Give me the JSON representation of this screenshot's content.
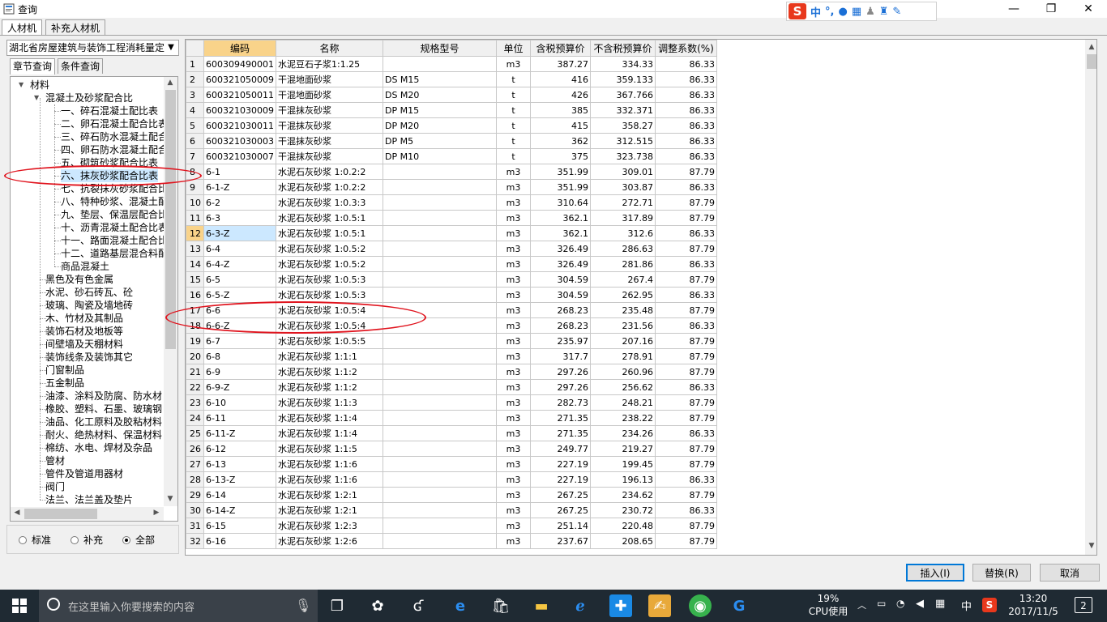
{
  "window": {
    "title": "查询",
    "ime": {
      "lang": "中"
    }
  },
  "tabs": [
    "人材机",
    "补充人材机"
  ],
  "left": {
    "dept_select": "湖北省房屋建筑与装饰工程消耗量定",
    "subtabs": [
      "章节查询",
      "条件查询"
    ],
    "tree": [
      {
        "label": "材料",
        "level": 0,
        "exp": "-"
      },
      {
        "label": "混凝土及砂浆配合比",
        "level": 1,
        "exp": "-"
      },
      {
        "label": "一、碎石混凝土配比表",
        "level": 2
      },
      {
        "label": "二、卵石混凝土配合比表",
        "level": 2
      },
      {
        "label": "三、碎石防水混凝土配合",
        "level": 2
      },
      {
        "label": "四、卵石防水混凝土配合",
        "level": 2
      },
      {
        "label": "五、砌筑砂浆配合比表",
        "level": 2
      },
      {
        "label": "六、抹灰砂浆配合比表",
        "level": 2,
        "sel": true
      },
      {
        "label": "七、抗裂抹灰砂浆配合比",
        "level": 2
      },
      {
        "label": "八、特种砂浆、混凝土配",
        "level": 2
      },
      {
        "label": "九、垫层、保温层配合比",
        "level": 2
      },
      {
        "label": "十、沥青混凝土配合比表",
        "level": 2
      },
      {
        "label": "十一、路面混凝土配合比",
        "level": 2
      },
      {
        "label": "十二、道路基层混合料配",
        "level": 2
      },
      {
        "label": "商品混凝土",
        "level": 2
      },
      {
        "label": "黑色及有色金属",
        "level": 1
      },
      {
        "label": "水泥、砂石砖瓦、砼",
        "level": 1
      },
      {
        "label": "玻璃、陶瓷及墙地砖",
        "level": 1
      },
      {
        "label": "木、竹材及其制品",
        "level": 1
      },
      {
        "label": "装饰石材及地板等",
        "level": 1
      },
      {
        "label": "间壁墙及天棚材料",
        "level": 1
      },
      {
        "label": "装饰线条及装饰其它",
        "level": 1
      },
      {
        "label": "门窗制品",
        "level": 1
      },
      {
        "label": "五金制品",
        "level": 1
      },
      {
        "label": "油漆、涂料及防腐、防水材",
        "level": 1
      },
      {
        "label": "橡胶、塑料、石墨、玻璃钢",
        "level": 1
      },
      {
        "label": "油品、化工原料及胶粘材料",
        "level": 1
      },
      {
        "label": "耐火、绝热材料、保温材料",
        "level": 1
      },
      {
        "label": "棉纺、水电、焊材及杂品",
        "level": 1
      },
      {
        "label": "管材",
        "level": 1
      },
      {
        "label": "管件及管道用器材",
        "level": 1
      },
      {
        "label": "阀门",
        "level": 1
      },
      {
        "label": "法兰、法兰盖及垫片",
        "level": 1
      }
    ],
    "radios": [
      {
        "label": "标准",
        "checked": false
      },
      {
        "label": "补充",
        "checked": false
      },
      {
        "label": "全部",
        "checked": true
      }
    ]
  },
  "grid": {
    "headers": [
      "编码",
      "名称",
      "规格型号",
      "单位",
      "含税预算价",
      "不含税预算价",
      "调整系数(%)"
    ],
    "rows": [
      [
        "1",
        "600309490001",
        "水泥豆石子浆1:1.25",
        "",
        "m3",
        "387.27",
        "334.33",
        "86.33"
      ],
      [
        "2",
        "600321050009",
        "干混地面砂浆",
        "DS M15",
        "t",
        "416",
        "359.133",
        "86.33"
      ],
      [
        "3",
        "600321050011",
        "干混地面砂浆",
        "DS M20",
        "t",
        "426",
        "367.766",
        "86.33"
      ],
      [
        "4",
        "600321030009",
        "干混抹灰砂浆",
        "DP M15",
        "t",
        "385",
        "332.371",
        "86.33"
      ],
      [
        "5",
        "600321030011",
        "干混抹灰砂浆",
        "DP M20",
        "t",
        "415",
        "358.27",
        "86.33"
      ],
      [
        "6",
        "600321030003",
        "干混抹灰砂浆",
        "DP M5",
        "t",
        "362",
        "312.515",
        "86.33"
      ],
      [
        "7",
        "600321030007",
        "干混抹灰砂浆",
        "DP M10",
        "t",
        "375",
        "323.738",
        "86.33"
      ],
      [
        "8",
        "6-1",
        "水泥石灰砂浆 1:0.2:2",
        "",
        "m3",
        "351.99",
        "309.01",
        "87.79"
      ],
      [
        "9",
        "6-1-Z",
        "水泥石灰砂浆 1:0.2:2",
        "",
        "m3",
        "351.99",
        "303.87",
        "86.33"
      ],
      [
        "10",
        "6-2",
        "水泥石灰砂浆 1:0.3:3",
        "",
        "m3",
        "310.64",
        "272.71",
        "87.79"
      ],
      [
        "11",
        "6-3",
        "水泥石灰砂浆 1:0.5:1",
        "",
        "m3",
        "362.1",
        "317.89",
        "87.79"
      ],
      [
        "12",
        "6-3-Z",
        "水泥石灰砂浆 1:0.5:1",
        "",
        "m3",
        "362.1",
        "312.6",
        "86.33"
      ],
      [
        "13",
        "6-4",
        "水泥石灰砂浆 1:0.5:2",
        "",
        "m3",
        "326.49",
        "286.63",
        "87.79"
      ],
      [
        "14",
        "6-4-Z",
        "水泥石灰砂浆 1:0.5:2",
        "",
        "m3",
        "326.49",
        "281.86",
        "86.33"
      ],
      [
        "15",
        "6-5",
        "水泥石灰砂浆 1:0.5:3",
        "",
        "m3",
        "304.59",
        "267.4",
        "87.79"
      ],
      [
        "16",
        "6-5-Z",
        "水泥石灰砂浆 1:0.5:3",
        "",
        "m3",
        "304.59",
        "262.95",
        "86.33"
      ],
      [
        "17",
        "6-6",
        "水泥石灰砂浆 1:0.5:4",
        "",
        "m3",
        "268.23",
        "235.48",
        "87.79"
      ],
      [
        "18",
        "6-6-Z",
        "水泥石灰砂浆 1:0.5:4",
        "",
        "m3",
        "268.23",
        "231.56",
        "86.33"
      ],
      [
        "19",
        "6-7",
        "水泥石灰砂浆 1:0.5:5",
        "",
        "m3",
        "235.97",
        "207.16",
        "87.79"
      ],
      [
        "20",
        "6-8",
        "水泥石灰砂浆 1:1:1",
        "",
        "m3",
        "317.7",
        "278.91",
        "87.79"
      ],
      [
        "21",
        "6-9",
        "水泥石灰砂浆 1:1:2",
        "",
        "m3",
        "297.26",
        "260.96",
        "87.79"
      ],
      [
        "22",
        "6-9-Z",
        "水泥石灰砂浆 1:1:2",
        "",
        "m3",
        "297.26",
        "256.62",
        "86.33"
      ],
      [
        "23",
        "6-10",
        "水泥石灰砂浆 1:1:3",
        "",
        "m3",
        "282.73",
        "248.21",
        "87.79"
      ],
      [
        "24",
        "6-11",
        "水泥石灰砂浆 1:1:4",
        "",
        "m3",
        "271.35",
        "238.22",
        "87.79"
      ],
      [
        "25",
        "6-11-Z",
        "水泥石灰砂浆 1:1:4",
        "",
        "m3",
        "271.35",
        "234.26",
        "86.33"
      ],
      [
        "26",
        "6-12",
        "水泥石灰砂浆 1:1:5",
        "",
        "m3",
        "249.77",
        "219.27",
        "87.79"
      ],
      [
        "27",
        "6-13",
        "水泥石灰砂浆 1:1:6",
        "",
        "m3",
        "227.19",
        "199.45",
        "87.79"
      ],
      [
        "28",
        "6-13-Z",
        "水泥石灰砂浆 1:1:6",
        "",
        "m3",
        "227.19",
        "196.13",
        "86.33"
      ],
      [
        "29",
        "6-14",
        "水泥石灰砂浆 1:2:1",
        "",
        "m3",
        "267.25",
        "234.62",
        "87.79"
      ],
      [
        "30",
        "6-14-Z",
        "水泥石灰砂浆 1:2:1",
        "",
        "m3",
        "267.25",
        "230.72",
        "86.33"
      ],
      [
        "31",
        "6-15",
        "水泥石灰砂浆 1:2:3",
        "",
        "m3",
        "251.14",
        "220.48",
        "87.79"
      ],
      [
        "32",
        "6-16",
        "水泥石灰砂浆 1:2:6",
        "",
        "m3",
        "237.67",
        "208.65",
        "87.79"
      ]
    ],
    "selected_row": 12
  },
  "buttons": {
    "insert": "插入(I)",
    "replace": "替换(R)",
    "cancel": "取消"
  },
  "taskbar": {
    "search_placeholder": "在这里输入你要搜索的内容",
    "cpu_percent": "19%",
    "cpu_label": "CPU使用",
    "time": "13:20",
    "date": "2017/11/5",
    "tray_lang": "中",
    "notif_count": "2"
  },
  "colors": {
    "accent": "#0078d7",
    "highlight": "#f9d38a",
    "selection": "#cce8ff",
    "annotation": "#e0141e"
  }
}
